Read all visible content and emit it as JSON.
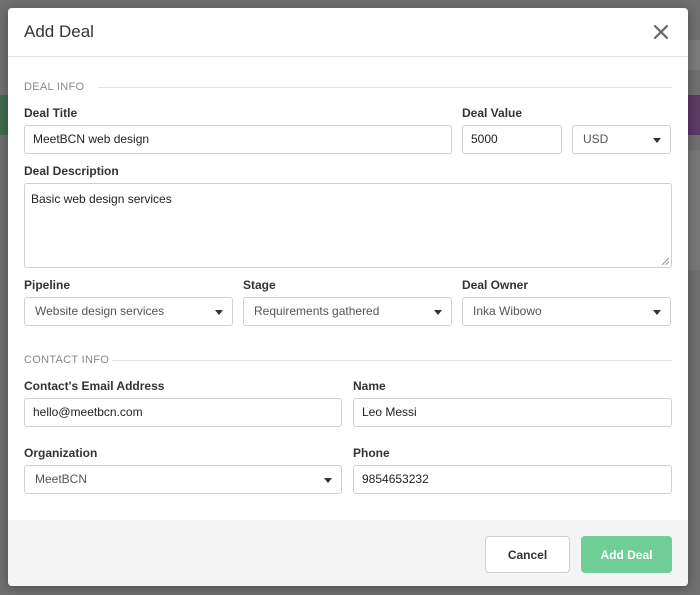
{
  "modal": {
    "title": "Add Deal"
  },
  "sections": {
    "deal_info": "DEAL INFO",
    "contact_info": "CONTACT INFO"
  },
  "deal": {
    "title_label": "Deal Title",
    "title_value": "MeetBCN web design",
    "value_label": "Deal Value",
    "value_value": "5000",
    "currency_value": "USD",
    "description_label": "Deal Description",
    "description_value": "Basic web design services",
    "pipeline_label": "Pipeline",
    "pipeline_value": "Website design services",
    "stage_label": "Stage",
    "stage_value": "Requirements gathered",
    "owner_label": "Deal Owner",
    "owner_value": "Inka Wibowo"
  },
  "contact": {
    "email_label": "Contact's Email Address",
    "email_value": "hello@meetbcn.com",
    "name_label": "Name",
    "name_value": "Leo Messi",
    "organization_label": "Organization",
    "organization_value": "MeetBCN",
    "phone_label": "Phone",
    "phone_value": "9854653232"
  },
  "footer": {
    "cancel_label": "Cancel",
    "add_label": "Add Deal"
  },
  "colors": {
    "primary": "#6fcf97",
    "overlay": "#6f6f6f"
  }
}
